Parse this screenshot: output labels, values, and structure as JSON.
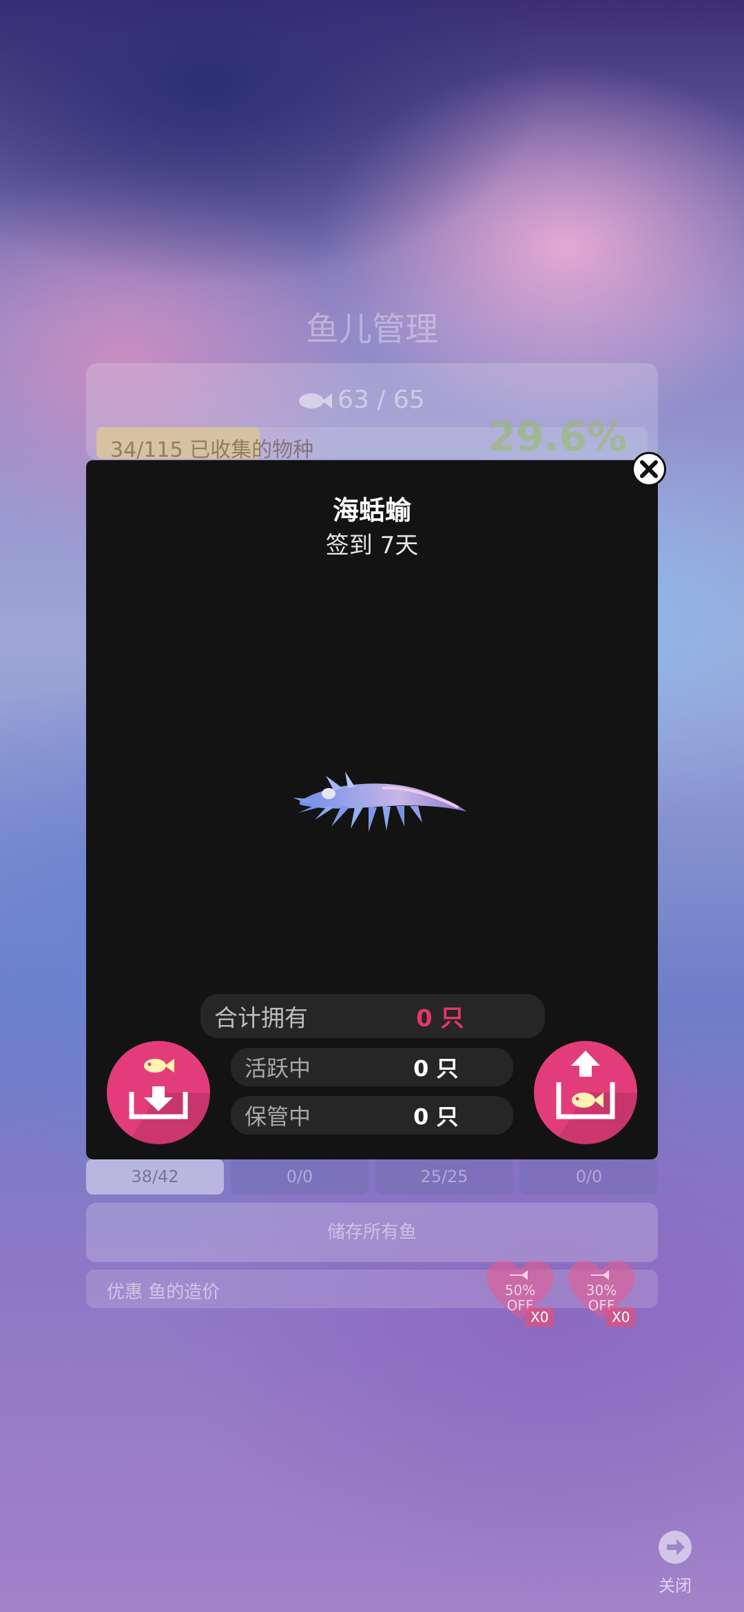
{
  "background": {
    "title": "鱼儿管理",
    "fish_count": "63 / 65",
    "progress_text": "34/115 已收集的物种",
    "progress_fraction": 0.296,
    "percent": "29.6%",
    "tabs": [
      "38/42",
      "0/0",
      "25/25",
      "0/0"
    ],
    "store_all_label": "储存所有鱼",
    "discount_label": "优惠 鱼的造价",
    "hearts": [
      {
        "pct": "50%",
        "off": "OFF",
        "count": "X0"
      },
      {
        "pct": "30%",
        "off": "OFF",
        "count": "X0"
      }
    ],
    "close_label": "关闭"
  },
  "modal": {
    "fish_name": "海蛞蝓",
    "subtitle": "签到 7天",
    "total_label": "合计拥有",
    "total_value": "0 只",
    "active_label": "活跃中",
    "active_value": "0 只",
    "stored_label": "保管中",
    "stored_value": "0 只"
  },
  "colors": {
    "modal_bg": "#131313",
    "pill_bg": "#262626",
    "accent_pink": "#e23d7a",
    "total_value": "#e8356a"
  },
  "icons": {
    "modal_close": "close-x-icon",
    "store_button": "fish-into-box-icon",
    "release_button": "fish-out-of-box-icon",
    "corner_close": "arrow-right-circle-icon"
  }
}
